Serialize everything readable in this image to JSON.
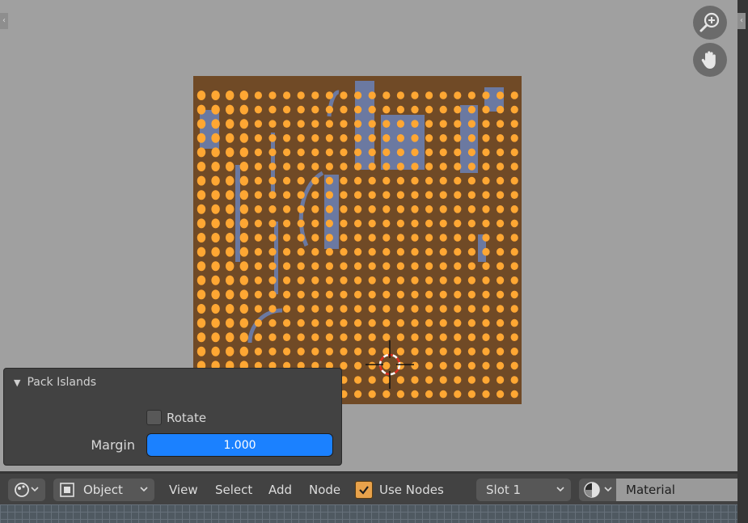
{
  "uv_editor": {
    "icons": {
      "zoom": "zoom-in-icon",
      "pan": "hand-pan-icon",
      "cursor": "3d-cursor-icon"
    },
    "colors": {
      "background": "#a0a0a0",
      "texture": "#704a26",
      "dot": "#ffa733",
      "island": "#6b79a1"
    }
  },
  "pack_islands_panel": {
    "title": "Pack Islands",
    "rotate": {
      "label": "Rotate",
      "checked": false
    },
    "margin": {
      "label": "Margin",
      "value": "1.000"
    }
  },
  "header": {
    "editor_type_icon": "editor-type-icon",
    "object_dropdown": {
      "icon": "object-icon",
      "label": "Object"
    },
    "menus": [
      "View",
      "Select",
      "Add",
      "Node"
    ],
    "use_nodes": {
      "label": "Use Nodes",
      "checked": true
    },
    "slot_dropdown": {
      "label": "Slot 1"
    },
    "material_preview_icon": "material-sphere-icon",
    "material_name": "Material"
  }
}
